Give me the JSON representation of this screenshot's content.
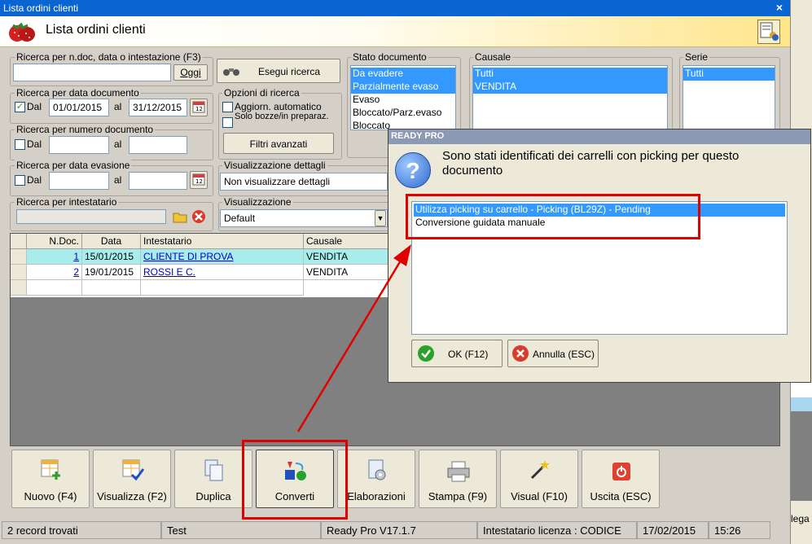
{
  "window": {
    "title": "Lista ordini clienti",
    "close_glyph": "×"
  },
  "header": {
    "title": "Lista ordini clienti"
  },
  "search_general": {
    "label": "Ricerca per n.doc, data o intestazione (F3)",
    "value": "",
    "btn_today": "Oggi",
    "btn_search": "Esegui ricerca"
  },
  "search_doc_date": {
    "label": "Ricerca per data documento",
    "checked": true,
    "from_label": "Dal",
    "from": "01/01/2015",
    "to_label": "al",
    "to": "31/12/2015"
  },
  "search_doc_num": {
    "label": "Ricerca per numero documento",
    "from_label": "Dal",
    "to_label": "al"
  },
  "search_eva": {
    "label": "Ricerca per data evasione",
    "from_label": "Dal",
    "to_label": "al"
  },
  "search_owner": {
    "label": "Ricerca per intestatario"
  },
  "options": {
    "label": "Opzioni di ricerca",
    "auto_update": "Aggiorn. automatico",
    "drafts": "Solo bozze/in preparaz.",
    "advanced": "Filtri avanzati"
  },
  "details": {
    "label": "Visualizzazione dettagli",
    "value": "Non visualizzare dettagli"
  },
  "view": {
    "label": "Visualizzazione",
    "value": "Default"
  },
  "stato": {
    "label": "Stato documento",
    "items": [
      "Da evadere",
      "Parzialmente evaso",
      "Evaso",
      "Bloccato/Parz.evaso",
      "Bloccato"
    ]
  },
  "causale": {
    "label": "Causale",
    "items": [
      "Tutti",
      "VENDITA"
    ]
  },
  "serie": {
    "label": "Serie",
    "items": [
      "Tutti"
    ]
  },
  "grid": {
    "headers": [
      "N.Doc.",
      "Data",
      "Intestatario",
      "Causale"
    ],
    "rows": [
      {
        "num": "1",
        "date": "15/01/2015",
        "owner": "CLIENTE DI PROVA",
        "causale": "VENDITA"
      },
      {
        "num": "2",
        "date": "19/01/2015",
        "owner": "ROSSI E C.",
        "causale": "VENDITA"
      }
    ]
  },
  "toolbar": [
    "Nuovo (F4)",
    "Visualizza (F2)",
    "Duplica",
    "Converti",
    "Elaborazioni",
    "Stampa (F9)",
    "Visual (F10)",
    "Uscita (ESC)"
  ],
  "status": {
    "records": "2 record trovati",
    "user": "Test",
    "version": "Ready Pro V17.1.7",
    "license": "Intestatario licenza : CODICE",
    "date": "17/02/2015",
    "time": "15:26"
  },
  "dialog": {
    "title": "READY PRO",
    "question_glyph": "?",
    "message": "Sono stati identificati dei carrelli con picking per questo documento",
    "options": [
      "Utilizza picking su carrello - Picking (BL29Z) - Pending",
      "Conversione guidata manuale"
    ],
    "ok": "OK (F12)",
    "cancel": "Annulla (ESC)"
  },
  "background_right": {
    "text": "lega"
  }
}
